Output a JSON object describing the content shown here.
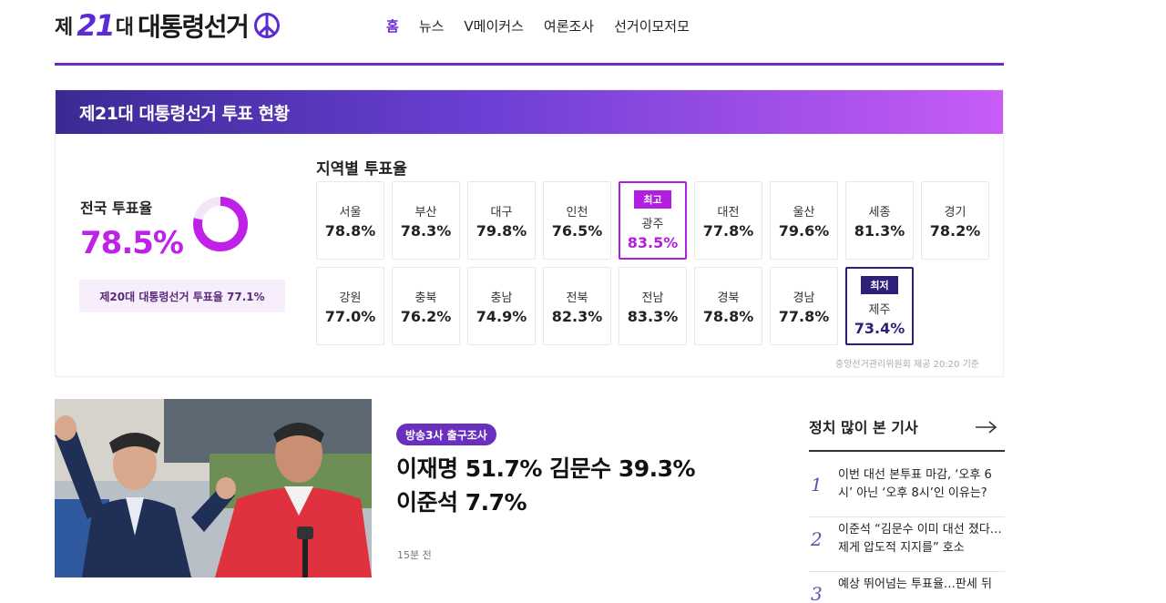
{
  "logo": {
    "pre": "제",
    "num": "21",
    "post": "대",
    "main": "대통령선거"
  },
  "nav": [
    "홈",
    "뉴스",
    "V메이커스",
    "여론조사",
    "선거이모저모"
  ],
  "turnout": {
    "panel_title": "제21대 대통령선거 투표 현황",
    "national_label": "전국 투표율",
    "national_value": "78.5%",
    "national_fraction": 0.785,
    "previous_text": "제20대 대통령선거 투표율 77.1%",
    "region_title": "지역별 투표율",
    "regions": [
      {
        "name": "서울",
        "value": "78.8%"
      },
      {
        "name": "부산",
        "value": "78.3%"
      },
      {
        "name": "대구",
        "value": "79.8%"
      },
      {
        "name": "인천",
        "value": "76.5%"
      },
      {
        "name": "광주",
        "value": "83.5%",
        "tag": "최고"
      },
      {
        "name": "대전",
        "value": "77.8%"
      },
      {
        "name": "울산",
        "value": "79.6%"
      },
      {
        "name": "세종",
        "value": "81.3%"
      },
      {
        "name": "경기",
        "value": "78.2%"
      },
      {
        "name": "강원",
        "value": "77.0%"
      },
      {
        "name": "충북",
        "value": "76.2%"
      },
      {
        "name": "충남",
        "value": "74.9%"
      },
      {
        "name": "전북",
        "value": "82.3%"
      },
      {
        "name": "전남",
        "value": "83.3%"
      },
      {
        "name": "경북",
        "value": "78.8%"
      },
      {
        "name": "경남",
        "value": "77.8%"
      },
      {
        "name": "제주",
        "value": "73.4%",
        "tag": "최저"
      }
    ],
    "source": "중앙선거관리위원회 제공 20:20 기준",
    "colors": {
      "accent": "#c021e8",
      "high": "#b21ee0",
      "low": "#2d1f7a"
    }
  },
  "news": {
    "badge": "방송3사 출구조사",
    "headline_line1": "이재명 51.7% 김문수 39.3%",
    "headline_line2": "이준석 7.7%",
    "time": "15분 전"
  },
  "popular": {
    "title": "정치 많이 본 기사",
    "items": [
      {
        "num": "1",
        "text": "이번 대선 본투표 마감, ‘오후 6시’ 아닌 ‘오후 8시’인 이유는?"
      },
      {
        "num": "2",
        "text": "이준석 “김문수 이미 대선 졌다…제게 압도적 지지를” 호소"
      },
      {
        "num": "3",
        "text": "예상 뛰어넘는 투표율…판세 뒤"
      }
    ]
  }
}
